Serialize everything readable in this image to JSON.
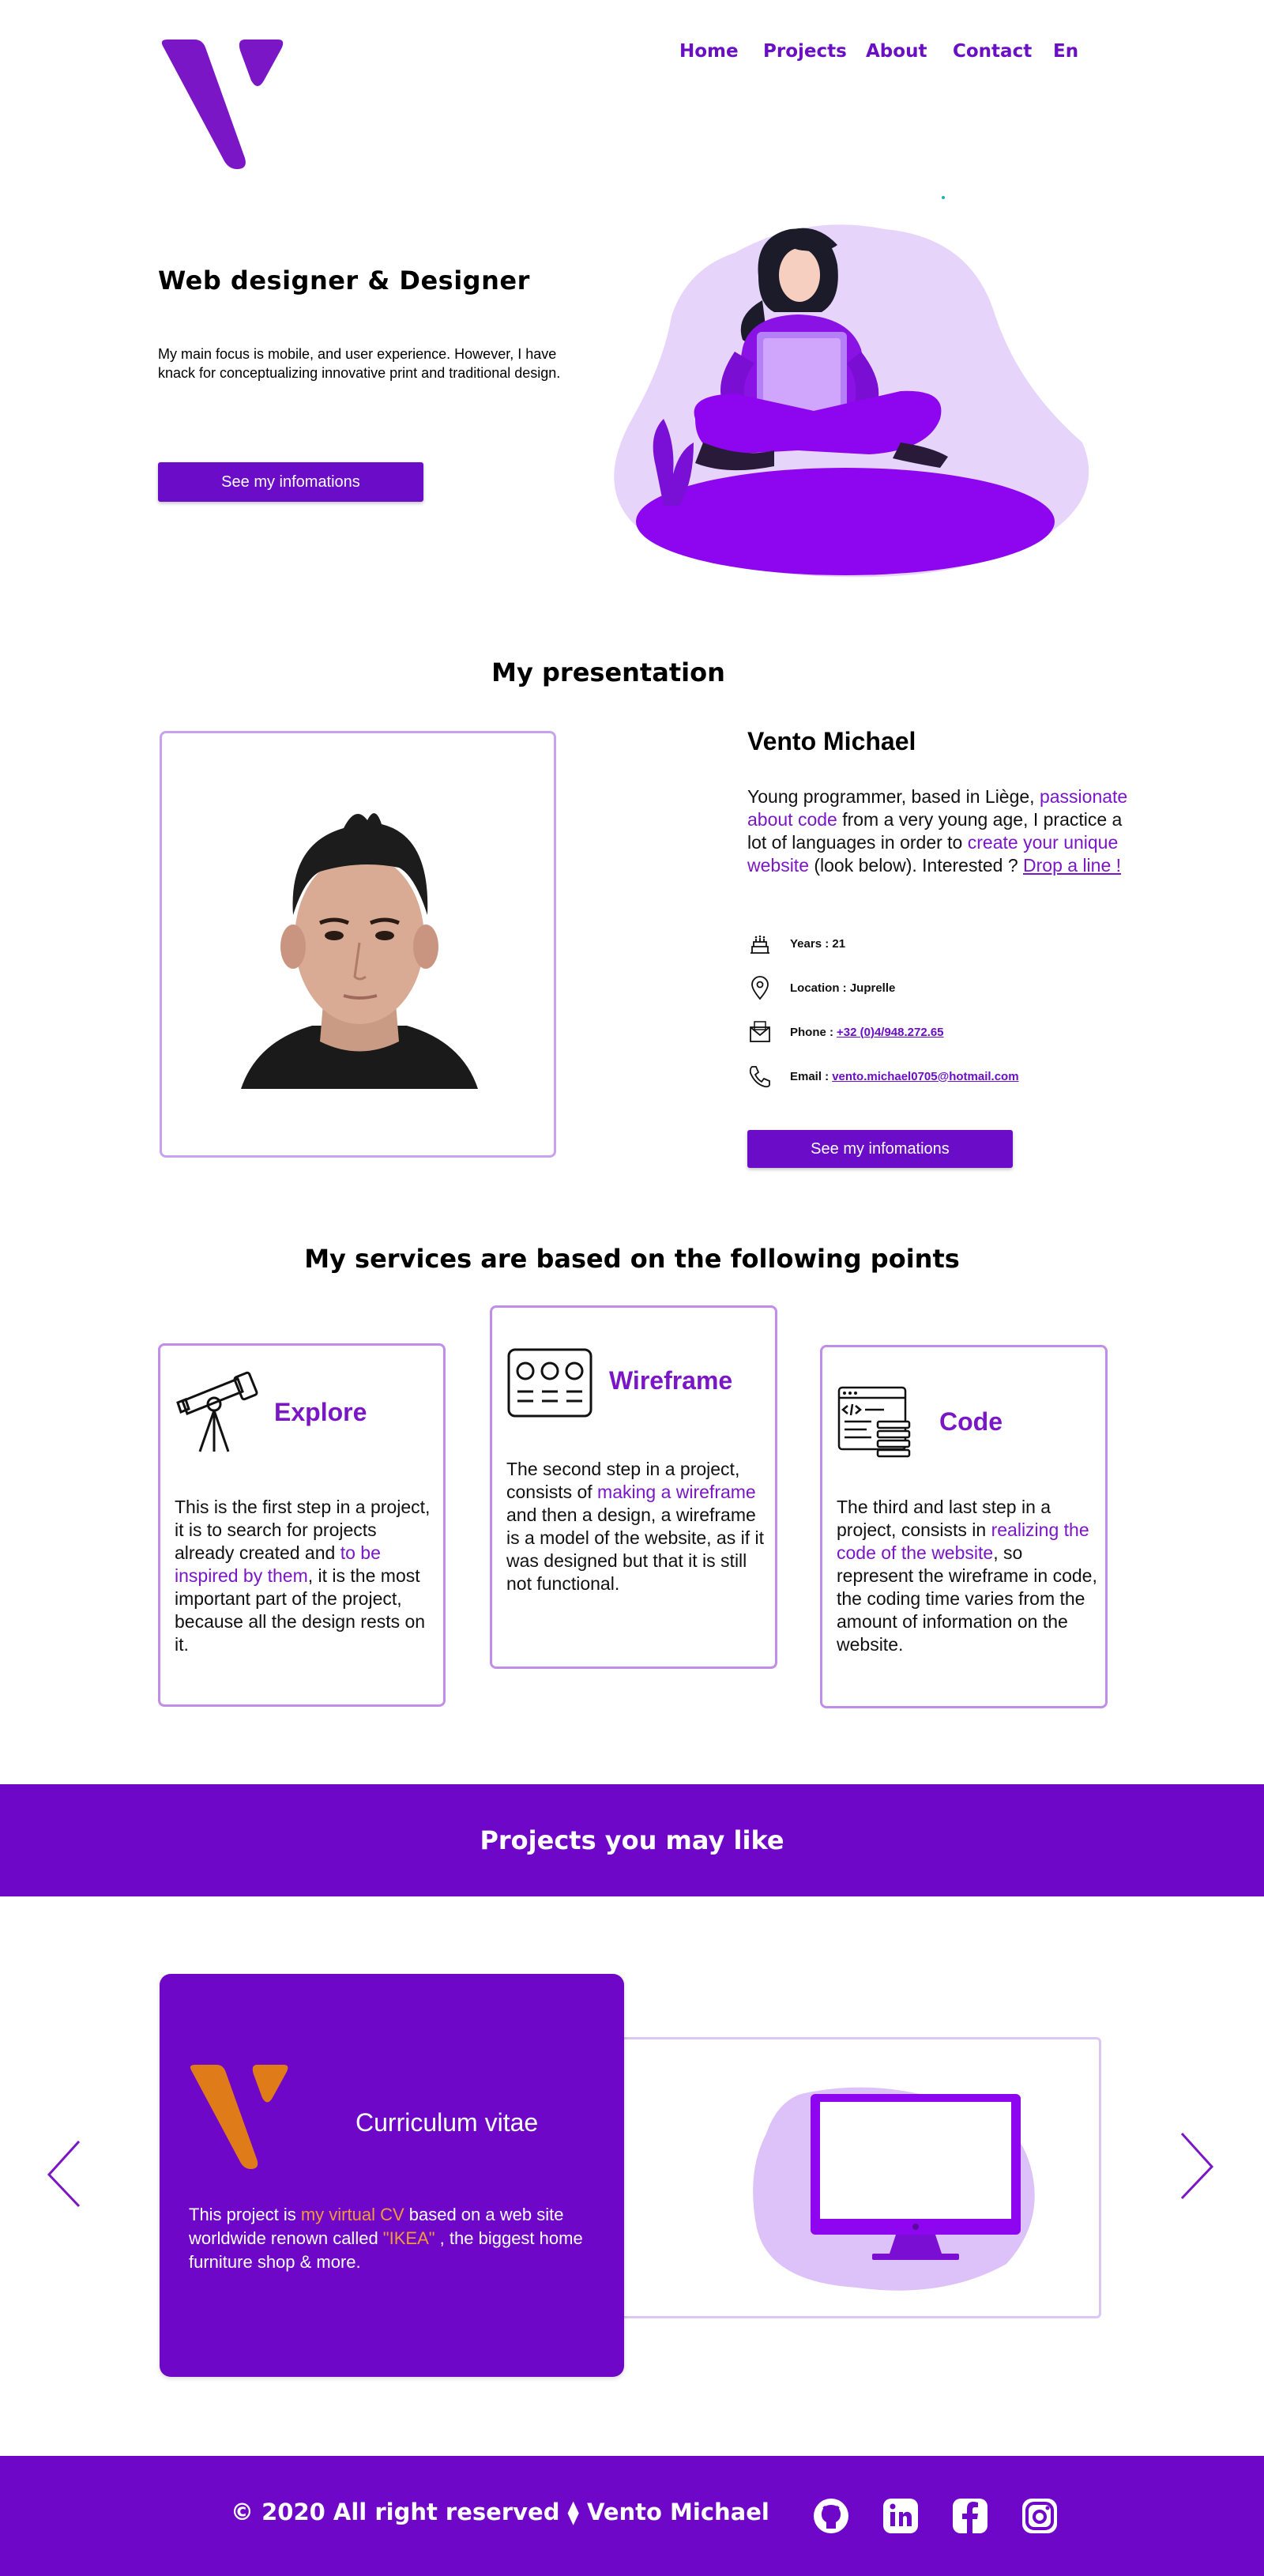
{
  "nav": {
    "home": "Home",
    "projects": "Projects",
    "about": "About",
    "contact": "Contact",
    "lang": "En"
  },
  "hero": {
    "title": "Web designer & Designer",
    "text": "My main focus is mobile, and user experience. However, I have knack for conceptualizing innovative print and traditional design.",
    "button": "See my infomations"
  },
  "presentation": {
    "title": "My presentation",
    "name": "Vento Michael",
    "bio": {
      "p1": "Young programmer, based in Liège, ",
      "h1": "passionate about code",
      "p2": " from a very young age, I practice a lot of languages in order to ",
      "h2": "create your unique website",
      "p3": " (look below). Interested ? ",
      "link": "Drop a line !"
    },
    "info": {
      "years_label": "Years : 21",
      "location_label": "Location : Juprelle",
      "phone_label": "Phone :",
      "phone_value": "+32 (0)4/948.272.65",
      "email_label": "Email :",
      "email_value": "vento.michael0705@hotmail.com"
    },
    "button": "See my infomations"
  },
  "services": {
    "title": "My services are based on the following points",
    "explore": {
      "title": "Explore",
      "t1": "This is the first step in a project, it is to search for projects already created and ",
      "h": "to be inspired by them",
      "t2": ", it is the most important part of the project, because all the design rests on it."
    },
    "wireframe": {
      "title": "Wireframe",
      "t1": "The second step in a project, consists of ",
      "h": "making a wireframe",
      "t2": " and then a design, a wireframe is a model of the website, as if it was designed but that it is still not functional."
    },
    "code": {
      "title": "Code",
      "t1": "The third and last step in a project, consists in ",
      "h": "realizing the code of the website",
      "t2": ", so represent the wireframe in code, the coding time varies from the amount of information on the website."
    }
  },
  "projects": {
    "banner": "Projects you may like",
    "card": {
      "title": "Curriculum vitae",
      "t1": "This project is ",
      "h1": "my virtual CV",
      "t2": "  based on a web site worldwide renown called ",
      "h2": " \"IKEA\"",
      "t3": " , the biggest home furniture shop & more."
    }
  },
  "footer": {
    "copyright": "© 2020 All right reserved ⧫ Vento Michael"
  },
  "icons": {
    "social": [
      "github-icon",
      "linkedin-icon",
      "facebook-icon",
      "instagram-icon"
    ]
  },
  "colors": {
    "primary": "#6e07c8",
    "accent": "#f39a3a",
    "border": "#c08ee8"
  }
}
